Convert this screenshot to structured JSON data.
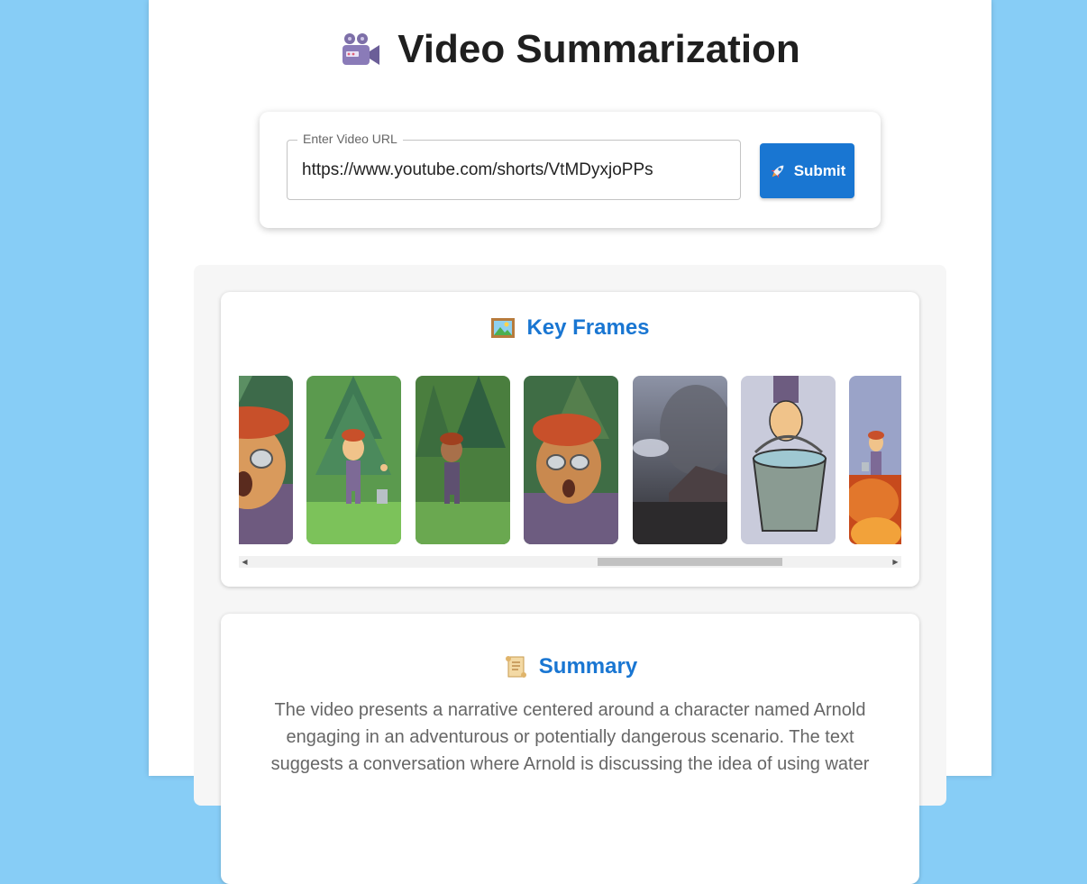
{
  "header": {
    "title": "Video Summarization",
    "icon": "movie-camera-icon"
  },
  "url_form": {
    "label": "Enter Video URL",
    "value": "https://www.youtube.com/shorts/VtMDyxjoPPs",
    "submit_label": "Submit",
    "submit_icon": "rocket-icon"
  },
  "key_frames": {
    "heading": "Key Frames",
    "icon": "framed-picture-icon",
    "frames": [
      {
        "scene": "character-closeup-glasses"
      },
      {
        "scene": "character-thumbs-up-forest"
      },
      {
        "scene": "character-dark-forest"
      },
      {
        "scene": "character-closeup-sad"
      },
      {
        "scene": "smoky-landscape"
      },
      {
        "scene": "hand-holding-bucket"
      },
      {
        "scene": "character-on-fire-rocks"
      }
    ]
  },
  "summary": {
    "heading": "Summary",
    "icon": "scroll-icon",
    "text": "The video presents a narrative centered around a character named Arnold engaging in an adventurous or potentially dangerous scenario. The text suggests a conversation where Arnold is discussing the idea of using water"
  },
  "colors": {
    "accent": "#1976d2",
    "background": "#87cdf6"
  }
}
